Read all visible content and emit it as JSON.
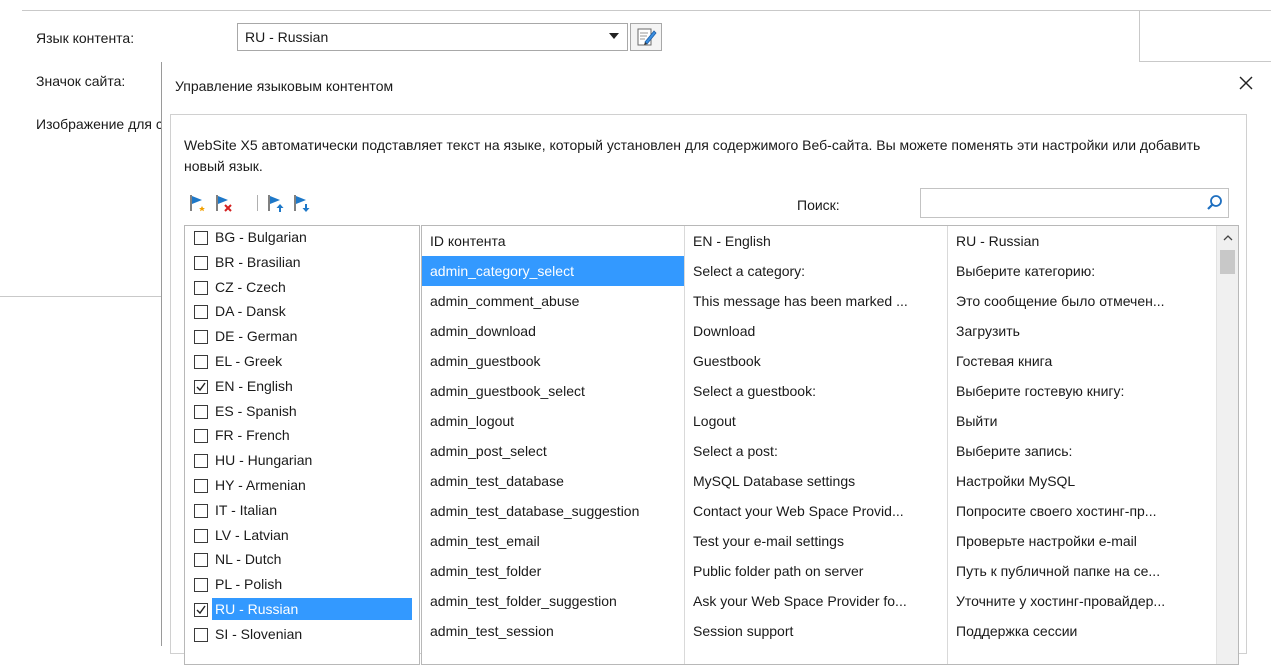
{
  "background": {
    "content_language_label": "Язык контента:",
    "content_language_value": "RU - Russian",
    "site_icon_label": "Значок сайта:",
    "image_label": "Изображение для с"
  },
  "dialog": {
    "title": "Управление языковым контентом",
    "description": "WebSite X5 автоматически подставляет текст на языке, который установлен для содержимого Веб-сайта. Вы можете поменять эти настройки или добавить новый язык.",
    "search_label": "Поиск:",
    "search_value": ""
  },
  "toolbar": {
    "icons": [
      "add-language-icon",
      "remove-language-icon",
      "move-up-icon",
      "move-down-icon"
    ]
  },
  "languages": [
    {
      "label": "BG - Bulgarian",
      "checked": false
    },
    {
      "label": "BR - Brasilian",
      "checked": false
    },
    {
      "label": "CZ - Czech",
      "checked": false
    },
    {
      "label": "DA - Dansk",
      "checked": false
    },
    {
      "label": "DE - German",
      "checked": false
    },
    {
      "label": "EL - Greek",
      "checked": false
    },
    {
      "label": "EN - English",
      "checked": true
    },
    {
      "label": "ES - Spanish",
      "checked": false
    },
    {
      "label": "FR - French",
      "checked": false
    },
    {
      "label": "HU - Hungarian",
      "checked": false
    },
    {
      "label": "HY - Armenian",
      "checked": false
    },
    {
      "label": "IT - Italian",
      "checked": false
    },
    {
      "label": "LV - Latvian",
      "checked": false
    },
    {
      "label": "NL - Dutch",
      "checked": false
    },
    {
      "label": "PL - Polish",
      "checked": false
    },
    {
      "label": "RU - Russian",
      "checked": true,
      "selected": true
    },
    {
      "label": "SI - Slovenian",
      "checked": false
    }
  ],
  "table": {
    "headers": [
      "ID контента",
      "EN - English",
      "RU - Russian"
    ],
    "rows": [
      [
        "admin_category_select",
        "Select a category:",
        "Выберите категорию:"
      ],
      [
        "admin_comment_abuse",
        "This message has been marked ...",
        "Это сообщение было отмечен..."
      ],
      [
        "admin_download",
        "Download",
        "Загрузить"
      ],
      [
        "admin_guestbook",
        "Guestbook",
        "Гостевая книга"
      ],
      [
        "admin_guestbook_select",
        "Select a guestbook:",
        "Выберите гостевую книгу:"
      ],
      [
        "admin_logout",
        "Logout",
        "Выйти"
      ],
      [
        "admin_post_select",
        "Select a post:",
        "Выберите запись:"
      ],
      [
        "admin_test_database",
        "MySQL Database settings",
        "Настройки MySQL"
      ],
      [
        "admin_test_database_suggestion",
        "Contact your Web Space Provid...",
        "Попросите своего хостинг-пр..."
      ],
      [
        "admin_test_email",
        "Test your e-mail settings",
        "Проверьте настройки e-mail"
      ],
      [
        "admin_test_folder",
        "Public folder path on server",
        "Путь к публичной папке на се..."
      ],
      [
        "admin_test_folder_suggestion",
        "Ask your Web Space Provider fo...",
        "Уточните у хостинг-провайдер..."
      ],
      [
        "admin_test_session",
        "Session support",
        "Поддержка сессии"
      ]
    ],
    "selected_row": 0
  },
  "colors": {
    "selection": "#3399ff",
    "flag_blue": "#1e78c8",
    "add_star": "#f2a000",
    "remove_x": "#d42020"
  }
}
